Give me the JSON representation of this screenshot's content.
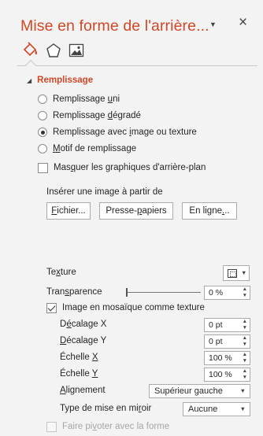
{
  "header": {
    "title": "Mise en forme de l'arrière...",
    "dropdown_glyph": "▼",
    "close_glyph": "×"
  },
  "tabs": [
    {
      "icon": "paint-bucket-icon",
      "active": true
    },
    {
      "icon": "pentagon-shape-icon",
      "active": false
    },
    {
      "icon": "picture-icon",
      "active": false
    }
  ],
  "section": {
    "caret": "◢",
    "label": "Remplissage"
  },
  "fill_options": [
    {
      "pre": "Remplissage ",
      "ul": "u",
      "post": "ni",
      "selected": false
    },
    {
      "pre": "Remplissage ",
      "ul": "d",
      "post": "égradé",
      "selected": false
    },
    {
      "pre": "Remplissage avec ",
      "ul": "i",
      "post": "mage ou texture",
      "selected": true
    },
    {
      "pre": "",
      "ul": "M",
      "post": "otif de remplissage",
      "selected": false
    }
  ],
  "hide_bg": {
    "pre": "Mas",
    "ul": "q",
    "post": "uer les graphiques d'arrière-plan",
    "checked": false
  },
  "insert_label": "Insérer une image à partir de",
  "buttons": {
    "file": {
      "ul": "F",
      "post": "ichier..."
    },
    "clipboard": {
      "pre": "Presse-",
      "ul": "p",
      "post": "apiers"
    },
    "online": {
      "pre": "En ligne",
      "ul": ".",
      "post": ".."
    }
  },
  "texture": {
    "pre": "Te",
    "ul": "x",
    "post": "ture"
  },
  "transparency": {
    "pre": "Tran",
    "ul": "s",
    "post": "parence",
    "value": "0 %",
    "level": 0
  },
  "tile": {
    "label": "Image en mosaïque comme texture",
    "checked": true
  },
  "offset_x": {
    "pre": "D",
    "ul": "é",
    "post": "calage X",
    "value": "0 pt"
  },
  "offset_y": {
    "pre": "",
    "ul": "D",
    "post": "écalage Y",
    "value": "0 pt"
  },
  "scale_x": {
    "pre": "Échelle ",
    "ul": "X",
    "post": "",
    "value": "100 %"
  },
  "scale_y": {
    "pre": "Échelle ",
    "ul": "Y",
    "post": "",
    "value": "100 %"
  },
  "alignment": {
    "pre": "",
    "ul": "A",
    "post": "lignement",
    "value": "Supérieur gauche"
  },
  "mirror": {
    "pre": "Type de mise en mi",
    "ul": "r",
    "post": "oir",
    "value": "Aucune"
  },
  "rotate": {
    "pre": "Faire pi",
    "ul": "v",
    "post": "oter avec la forme",
    "checked": false,
    "enabled": false
  },
  "colors": {
    "accent": "#d24726",
    "background": "#f3f3f3"
  }
}
